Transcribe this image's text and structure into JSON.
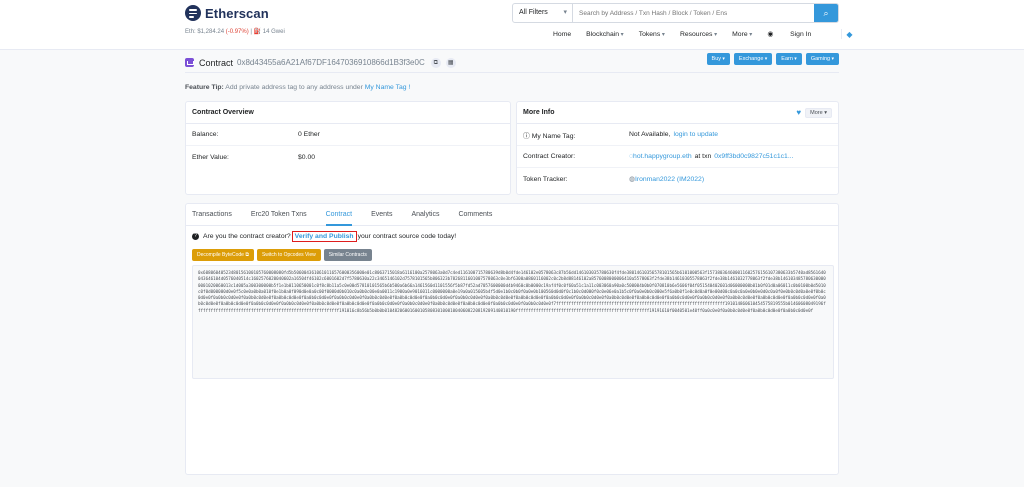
{
  "brand": {
    "name": "Etherscan"
  },
  "price": {
    "label": "Eth: $1,284.24",
    "change": "(-0.97%)",
    "gas": "14 Gwei"
  },
  "search": {
    "filter": "All Filters",
    "placeholder": "Search by Address / Txn Hash / Block / Token / Ens"
  },
  "nav": {
    "items": [
      "Home",
      "Blockchain",
      "Tokens",
      "Resources",
      "More"
    ],
    "signin": "Sign In"
  },
  "contract": {
    "title": "Contract",
    "address": "0x8d43455a6A21Af67DF1647036910866d1B3f3e0C",
    "buttons": [
      "Buy",
      "Exchange",
      "Earn",
      "Gaming"
    ]
  },
  "tip": {
    "label": "Feature Tip:",
    "text": "Add private address tag to any address under",
    "link": "My Name Tag !"
  },
  "overview": {
    "title": "Contract Overview",
    "rows": [
      {
        "label": "Balance:",
        "value": "0 Ether"
      },
      {
        "label": "Ether Value:",
        "value": "$0.00"
      }
    ]
  },
  "moreinfo": {
    "title": "More Info",
    "more_btn": "More",
    "nametag_label": "My Name Tag:",
    "nametag_value": "Not Available,",
    "nametag_link": "login to update",
    "creator_label": "Contract Creator:",
    "creator_addr": "hot.happygroup.eth",
    "creator_at": "at txn",
    "creator_txn": "0x9ff3bd0c9827c51c1c1...",
    "tracker_label": "Token Tracker:",
    "tracker_value": "Ironman2022 (IM2022)"
  },
  "tabs": [
    "Transactions",
    "Erc20 Token Txns",
    "Contract",
    "Events",
    "Analytics",
    "Comments"
  ],
  "notice": {
    "pre": "Are you the contract creator?",
    "link": "Verify and Publish",
    "post": "your contract source code today!"
  },
  "code_buttons": [
    "Decompile ByteCode",
    "Switch to Opcodes View",
    "Similar Contracts"
  ],
  "bytecode": "0x60806040523480156100105760008080fd5b5060043610610116576000356000e01c8063715018a6116100a2578063a0d7c4ed116100715780639d8b0d4fde146102e0578063c87b56dd146103035780630f4fde38014610356578101565b6101000563f157380364600011602576156107380633b5740ad8561640043646104d0576040514c1602576020040602a16504f46102c6001602d7f5780630a22c3465146102d7578101565b806323b7826811601007578063c0e3bf6300a0860116002c0c2b8d88146102a8576008000006410a5578063f2fde38b14610305578063f2fde38b1461032778063f2fde38b1461034857806300000001020060013c1d005a300300000b5f1e1b0110650001c0f8c8b11a5c0e00d57810101565b6b500a6b66a1461560d1101556f5b87fd52ad7057600000d4b9460c0b0000c19af4f0c0f60a51c1a11c003060a90a0c500004b0b0f070810b6e5606f04f051540402601d06000000b01b0f01d0a06011c0b0100b0d5010c0f0d000000d0e0f5c0e0a0b0a010f0e1b0a0f090d0e0a0c00f0000d0b010c0a0b0c00e0a0011c1900a0e9016011c0000000a0e19a0a015605b4f5d0e1b0c0b0f0a0e0b100560d0d0f0c1b0c0d000f0c0e06e0a1b5c0f0a0e0b0c000e5f6a0b0f1e0c0d0a0f0e00d00c0a0c0a0e0b0e0d0c0a0f0e0b0c0d0a0e0f0b0c0d0e0f0a0b0c0d0e0f0a0b0c0d0e0f0a0b0c0d0e0f0a0b0c0d0e0f0a0b0c0d0e0f0a0b0c0d0e0f0a0b0c0d0e0f0a0b0c0d0e0f0a0b0c0d0e0f0a0b0c0d0e0f0a0b0c0d0e0f0a0b0c0d0e0f0a0b0c0d0e0f0a0b0c0d0e0f0a0b0c0d0e0f0a0b0c0d0e0f0a0b0c0d0e0f0a0b0c0d0e0f0a0b0c0d0e0f0a0b0c0d0e0f0a0b0c0d0e0f0a0b0c0d0e0f0a0b0c0d0e0f0a0b0c0d0e0f0a0b0c0d0e0f0a0b0c0d0e0f0a0b0c0d0e0f0a0b0c0d0e0f0a0b0c0d0e0f0a0b0c0d0e0f0a0b0c0d0e0f0a0b0c0d0e0f7fffffffffffffffffffffffffffffffffffffffffffffffffffffffffffffffffff191014860610454575819555b01460608049196fffffffffffffffffffffffffffffffffffffffffffffffffffffffff191016c8b56b5b0b0b0104820600160010580830100010040608220819209140810190fffffffffffffffffffffffffffffffffffffffffffffffffffff19191610f0040501e40ff0a0c0e0f0a0b0c0d0e0f0a0b0c0d0e0f0a0b0c0d0e0f"
}
